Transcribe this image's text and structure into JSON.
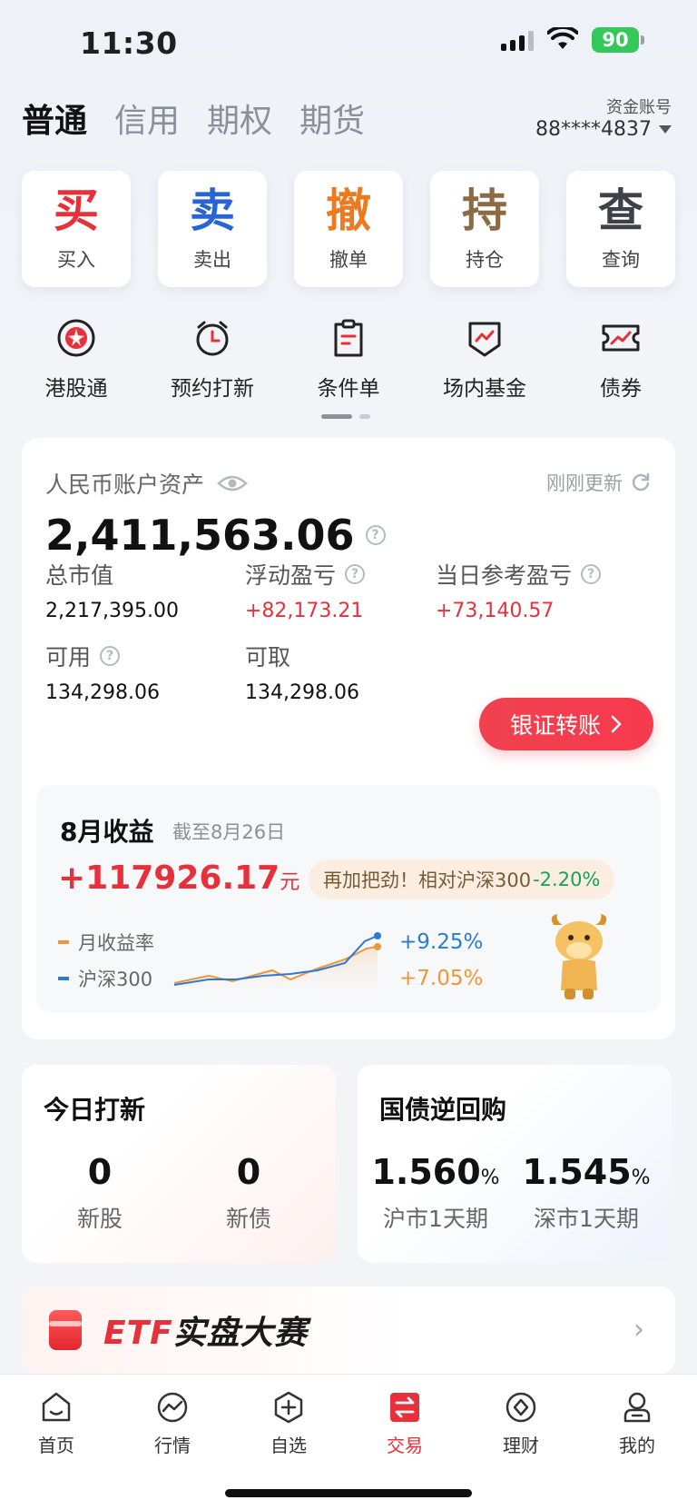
{
  "status": {
    "time": "11:30",
    "battery": "90"
  },
  "account_tabs": [
    "普通",
    "信用",
    "期权",
    "期货"
  ],
  "fund_account": {
    "label": "资金账号",
    "number": "88****4837"
  },
  "quick_actions": [
    {
      "big": "买",
      "label": "买入",
      "color": "#e8303b"
    },
    {
      "big": "卖",
      "label": "卖出",
      "color": "#2a63d6"
    },
    {
      "big": "撤",
      "label": "撤单",
      "color": "#ec7a21"
    },
    {
      "big": "持",
      "label": "持仓",
      "color": "#8c6a43"
    },
    {
      "big": "查",
      "label": "查询",
      "color": "#3e4149"
    }
  ],
  "tools": [
    {
      "label": "港股通",
      "icon": "hk-flower-icon"
    },
    {
      "label": "预约打新",
      "icon": "alarm-clock-icon"
    },
    {
      "label": "条件单",
      "icon": "clipboard-icon"
    },
    {
      "label": "场内基金",
      "icon": "shield-chart-icon"
    },
    {
      "label": "债券",
      "icon": "ticket-chart-icon"
    }
  ],
  "assets": {
    "title": "人民币账户资产",
    "refresh": "刚刚更新",
    "total": "2,411,563.06",
    "market_value_label": "总市值",
    "market_value": "2,217,395.00",
    "float_pl_label": "浮动盈亏",
    "float_pl": "+82,173.21",
    "daily_pl_label": "当日参考盈亏",
    "daily_pl": "+73,140.57",
    "available_label": "可用",
    "available": "134,298.06",
    "withdrawable_label": "可取",
    "withdrawable": "134,298.06",
    "transfer_button": "银证转账"
  },
  "monthly": {
    "title": "8月收益",
    "date": "截至8月26日",
    "amount": "+117926.17",
    "unit": "元",
    "bubble_text": "再加把劲！相对沪深300",
    "bubble_value": "-2.20%",
    "legend_return": "月收益率",
    "legend_index": "沪深300",
    "return_pct": "+9.25%",
    "index_pct": "+7.05%",
    "colors": {
      "return": "#f0953a",
      "index": "#2a7ad6"
    }
  },
  "ipo": {
    "title": "今日打新",
    "stocks_count": "0",
    "stocks_label": "新股",
    "bonds_count": "0",
    "bonds_label": "新债"
  },
  "repo": {
    "title": "国债逆回购",
    "sh_rate": "1.560",
    "sh_label": "沪市1天期",
    "sz_rate": "1.545",
    "sz_label": "深市1天期",
    "pct": "%"
  },
  "banner": {
    "prefix": "ETF",
    "text": "实盘大赛"
  },
  "tabbar": [
    {
      "label": "首页",
      "icon": "home-icon"
    },
    {
      "label": "行情",
      "icon": "market-icon"
    },
    {
      "label": "自选",
      "icon": "watchlist-icon"
    },
    {
      "label": "交易",
      "icon": "trade-icon"
    },
    {
      "label": "理财",
      "icon": "wealth-icon"
    },
    {
      "label": "我的",
      "icon": "profile-icon"
    }
  ]
}
